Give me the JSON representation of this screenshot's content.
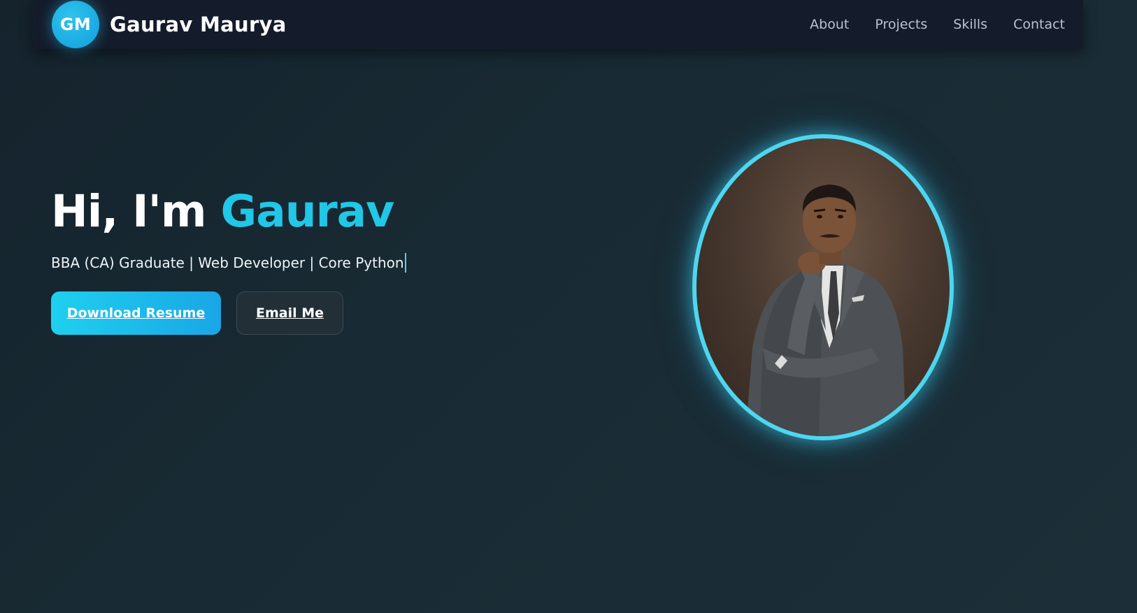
{
  "brand": {
    "logo_initials": "GM",
    "name": "Gaurav Maurya"
  },
  "nav": {
    "items": [
      {
        "label": "About"
      },
      {
        "label": "Projects"
      },
      {
        "label": "Skills"
      },
      {
        "label": "Contact"
      }
    ]
  },
  "hero": {
    "greeting": "Hi, I'm",
    "highlight_name": "Gaurav",
    "subtitle": "BBA (CA) Graduate | Web Developer | Core Python",
    "primary_button": "Download Resume",
    "secondary_button": "Email Me"
  },
  "portrait": {
    "image": "profile-photo"
  },
  "colors": {
    "accent": "#22c6e6",
    "background": "#182a33",
    "navbar": "#141b2a",
    "ring": "#4fd6ef"
  }
}
